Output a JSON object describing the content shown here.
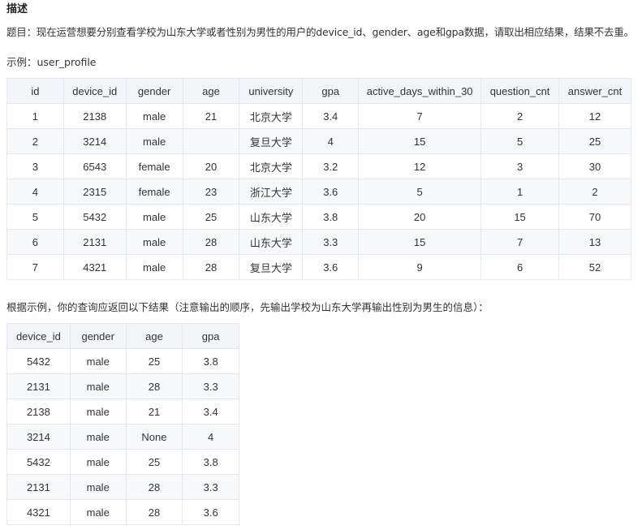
{
  "heading": "描述",
  "question": "题目：现在运营想要分别查看学校为山东大学或者性别为男性的用户的device_id、gender、age和gpa数据，请取出相应结果，结果不去重。",
  "example_label": "示例：user_profile",
  "table1": {
    "columns": [
      "id",
      "device_id",
      "gender",
      "age",
      "university",
      "gpa",
      "active_days_within_30",
      "question_cnt",
      "answer_cnt"
    ],
    "rows": [
      [
        "1",
        "2138",
        "male",
        "21",
        "北京大学",
        "3.4",
        "7",
        "2",
        "12"
      ],
      [
        "2",
        "3214",
        "male",
        "",
        "复旦大学",
        "4",
        "15",
        "5",
        "25"
      ],
      [
        "3",
        "6543",
        "female",
        "20",
        "北京大学",
        "3.2",
        "12",
        "3",
        "30"
      ],
      [
        "4",
        "2315",
        "female",
        "23",
        "浙江大学",
        "3.6",
        "5",
        "1",
        "2"
      ],
      [
        "5",
        "5432",
        "male",
        "25",
        "山东大学",
        "3.8",
        "20",
        "15",
        "70"
      ],
      [
        "6",
        "2131",
        "male",
        "28",
        "山东大学",
        "3.3",
        "15",
        "7",
        "13"
      ],
      [
        "7",
        "4321",
        "male",
        "28",
        "复旦大学",
        "3.6",
        "9",
        "6",
        "52"
      ]
    ]
  },
  "result_label": "根据示例，你的查询应返回以下结果（注意输出的顺序，先输出学校为山东大学再输出性别为男生的信息）：",
  "table2": {
    "columns": [
      "device_id",
      "gender",
      "age",
      "gpa"
    ],
    "rows": [
      [
        "5432",
        "male",
        "25",
        "3.8"
      ],
      [
        "2131",
        "male",
        "28",
        "3.3"
      ],
      [
        "2138",
        "male",
        "21",
        "3.4"
      ],
      [
        "3214",
        "male",
        "None",
        "4"
      ],
      [
        "5432",
        "male",
        "25",
        "3.8"
      ],
      [
        "2131",
        "male",
        "28",
        "3.3"
      ],
      [
        "4321",
        "male",
        "28",
        "3.6"
      ]
    ]
  }
}
